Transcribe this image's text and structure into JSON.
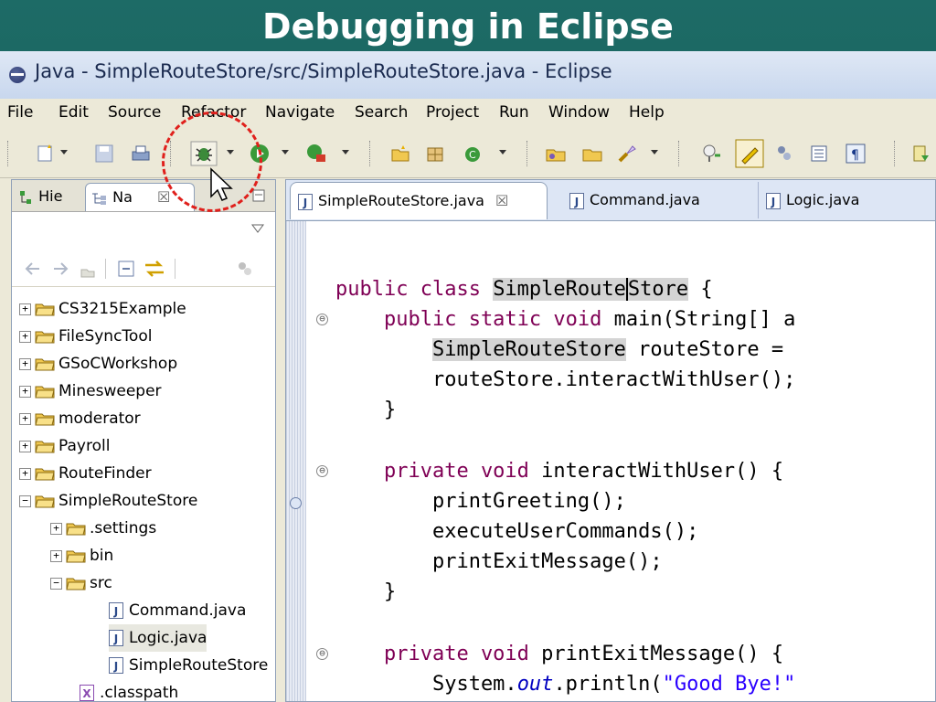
{
  "slide": {
    "title": "Debugging in Eclipse"
  },
  "window": {
    "title": "Java - SimpleRouteStore/src/SimpleRouteStore.java - Eclipse"
  },
  "menu": [
    "File",
    "Edit",
    "Source",
    "Refactor",
    "Navigate",
    "Search",
    "Project",
    "Run",
    "Window",
    "Help"
  ],
  "left_tabs": [
    {
      "label": "Hie"
    },
    {
      "label": "Na",
      "close": "☒"
    }
  ],
  "tree": [
    {
      "label": "CS3215Example",
      "expander": "+"
    },
    {
      "label": "FileSyncTool",
      "expander": "+"
    },
    {
      "label": "GSoCWorkshop",
      "expander": "+"
    },
    {
      "label": "Minesweeper",
      "expander": "+"
    },
    {
      "label": "moderator",
      "expander": "+"
    },
    {
      "label": "Payroll",
      "expander": "+"
    },
    {
      "label": "RouteFinder",
      "expander": "+"
    },
    {
      "label": "SimpleRouteStore",
      "expander": "−"
    },
    {
      "label": ".settings",
      "expander": "+"
    },
    {
      "label": "bin",
      "expander": "+"
    },
    {
      "label": "src",
      "expander": "−"
    },
    {
      "label": "Command.java"
    },
    {
      "label": "Logic.java"
    },
    {
      "label": "SimpleRouteStore"
    },
    {
      "label": ".classpath"
    }
  ],
  "editor_tabs": [
    {
      "label": "SimpleRouteStore.java",
      "close": "☒"
    },
    {
      "label": "Command.java"
    },
    {
      "label": "Logic.java"
    }
  ],
  "code": {
    "l1a": "public class ",
    "l1b": "SimpleRoute",
    "l1c": "Store",
    "l1d": " {",
    "l2a": "    public static void ",
    "l2b": "main(String[] a",
    "l3a": "        ",
    "l3b": "SimpleRouteStore",
    "l3c": " routeStore =",
    "l4": "        routeStore.interactWithUser();",
    "l5": "    }",
    "l6a": "    private void ",
    "l6b": "interactWithUser() {",
    "l7": "        printGreeting();",
    "l8": "        executeUserCommands();",
    "l9": "        printExitMessage();",
    "l10": "    }",
    "l11a": "    private void ",
    "l11b": "printExitMessage() {",
    "l12a": "        System.",
    "l12b": "out",
    "l12c": ".println(",
    "l12d": "\"Good Bye!\"",
    "l13": "    }"
  },
  "fold_markers": [
    "⊖",
    "⊖",
    "⊖"
  ],
  "colors": {
    "slide_bg": "#1d6b66",
    "keyword": "#7f0055",
    "string": "#2a00ff",
    "highlight_circle": "#e0201c"
  }
}
